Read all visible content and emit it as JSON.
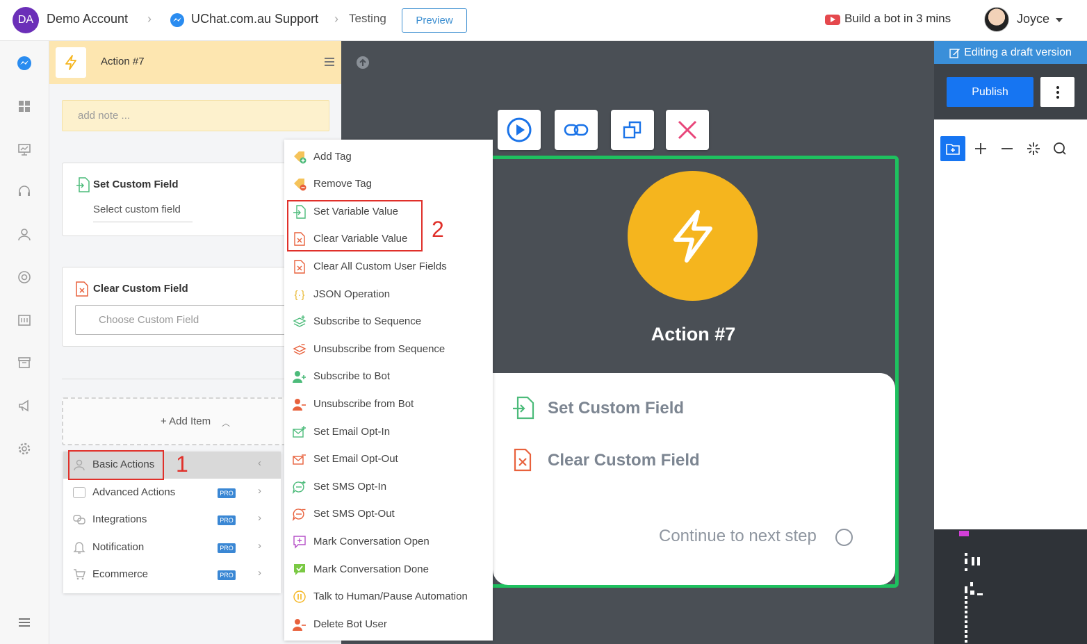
{
  "header": {
    "account_initials": "DA",
    "account_name": "Demo Account",
    "bot_name": "UChat.com.au Support",
    "flow_name": "Testing",
    "preview_label": "Preview",
    "build_bot_label": "Build a bot in 3 mins",
    "user_name": "Joyce"
  },
  "panel": {
    "title": "Action #7",
    "note_placeholder": "add note ...",
    "set_custom_field": {
      "title": "Set Custom Field",
      "select_placeholder": "Select custom field"
    },
    "clear_custom_field": {
      "title": "Clear Custom Field",
      "select_placeholder": "Choose Custom Field"
    },
    "add_item_label": "+ Add Item"
  },
  "categories": [
    {
      "label": "Basic Actions",
      "pro": ""
    },
    {
      "label": "Advanced Actions",
      "pro": "PRO"
    },
    {
      "label": "Integrations",
      "pro": "PRO"
    },
    {
      "label": "Notification",
      "pro": "PRO"
    },
    {
      "label": "Ecommerce",
      "pro": "PRO"
    }
  ],
  "action_menu": [
    {
      "label": "Add Tag",
      "icon": "tag-add-icon"
    },
    {
      "label": "Remove Tag",
      "icon": "tag-remove-icon"
    },
    {
      "label": "Set Variable Value",
      "icon": "set-variable-icon"
    },
    {
      "label": "Clear Variable Value",
      "icon": "clear-variable-icon"
    },
    {
      "label": "Clear All Custom User Fields",
      "icon": "clear-fields-icon"
    },
    {
      "label": "JSON Operation",
      "icon": "json-icon"
    },
    {
      "label": "Subscribe to Sequence",
      "icon": "subscribe-sequence-icon"
    },
    {
      "label": "Unsubscribe from Sequence",
      "icon": "unsubscribe-sequence-icon"
    },
    {
      "label": "Subscribe to Bot",
      "icon": "subscribe-bot-icon"
    },
    {
      "label": "Unsubscribe from Bot",
      "icon": "unsubscribe-bot-icon"
    },
    {
      "label": "Set Email Opt-In",
      "icon": "email-optin-icon"
    },
    {
      "label": "Set Email Opt-Out",
      "icon": "email-optout-icon"
    },
    {
      "label": "Set SMS Opt-In",
      "icon": "sms-optin-icon"
    },
    {
      "label": "Set SMS Opt-Out",
      "icon": "sms-optout-icon"
    },
    {
      "label": "Mark Conversation Open",
      "icon": "conversation-open-icon"
    },
    {
      "label": "Mark Conversation Done",
      "icon": "conversation-done-icon"
    },
    {
      "label": "Talk to Human/Pause Automation",
      "icon": "pause-icon"
    },
    {
      "label": "Delete Bot User",
      "icon": "delete-user-icon"
    }
  ],
  "node": {
    "title": "Action #7",
    "items": [
      "Set Custom Field",
      "Clear Custom Field"
    ],
    "continue_label": "Continue to next step"
  },
  "right": {
    "editing_label": "Editing a draft version",
    "publish_label": "Publish"
  },
  "annotations": {
    "step1": "1",
    "step2": "2"
  },
  "colors": {
    "accent": "#1675f2",
    "node_border": "#1ec15f",
    "node_circle": "#f5b51e",
    "highlight": "#e0302a"
  }
}
